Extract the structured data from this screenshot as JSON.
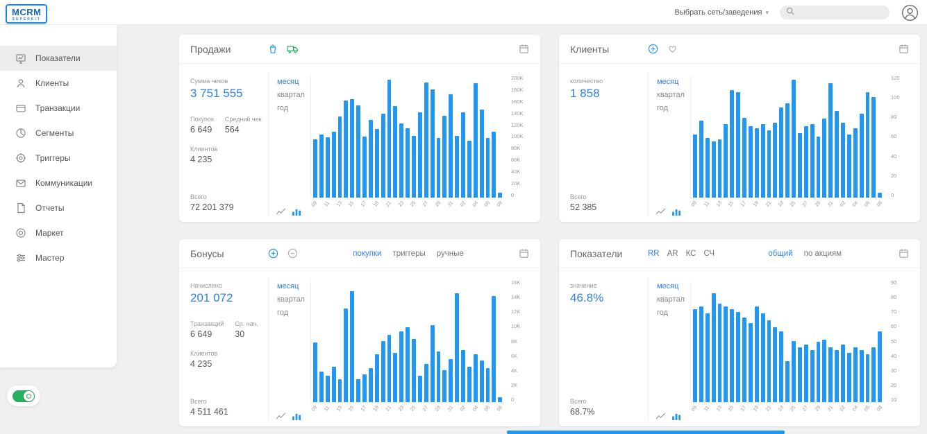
{
  "header": {
    "logo_title": "MCRM",
    "logo_subtitle": "SUPERKIT",
    "network_select": "Выбрать сеть/заведения",
    "search_placeholder": "",
    "icons": [
      "chevron-down-icon",
      "search-icon",
      "profile-icon"
    ]
  },
  "sidebar": {
    "items": [
      {
        "key": "metrics",
        "label": "Показатели",
        "icon": "metrics-icon",
        "active": true
      },
      {
        "key": "clients",
        "label": "Клиенты",
        "icon": "clients-icon",
        "active": false
      },
      {
        "key": "transactions",
        "label": "Транзакции",
        "icon": "transactions-icon",
        "active": false
      },
      {
        "key": "segments",
        "label": "Сегменты",
        "icon": "segments-icon",
        "active": false
      },
      {
        "key": "triggers",
        "label": "Триггеры",
        "icon": "triggers-icon",
        "active": false
      },
      {
        "key": "communications",
        "label": "Коммуникации",
        "icon": "communications-icon",
        "active": false
      },
      {
        "key": "reports",
        "label": "Отчеты",
        "icon": "reports-icon",
        "active": false
      },
      {
        "key": "market",
        "label": "Маркет",
        "icon": "market-icon",
        "active": false
      },
      {
        "key": "master",
        "label": "Мастер",
        "icon": "master-icon",
        "active": false
      }
    ],
    "toggle_on": true
  },
  "cards": {
    "period_tabs": [
      "месяц",
      "квартал",
      "год"
    ],
    "active_period": "месяц",
    "sales": {
      "title": "Продажи",
      "icons": [
        "bag-icon",
        "delivery-truck-icon",
        "calendar-icon"
      ],
      "stats": {
        "main_label": "Сумма чеков",
        "main_value": "3 751 555",
        "row2": [
          {
            "label": "Покупок",
            "value": "6 649"
          },
          {
            "label": "Средний чек",
            "value": "564"
          }
        ],
        "row3": {
          "label": "Клиентов",
          "value": "4 235"
        },
        "total": {
          "label": "Всего",
          "value": "72 201 379"
        }
      }
    },
    "clients": {
      "title": "Клиенты",
      "icons": [
        "plus-circle-icon",
        "heart-icon",
        "calendar-icon"
      ],
      "stats": {
        "main_label": "количество",
        "main_value": "1 858",
        "total": {
          "label": "Всего",
          "value": "52 385"
        }
      }
    },
    "bonuses": {
      "title": "Бонусы",
      "icons": [
        "plus-circle-icon",
        "minus-circle-icon",
        "calendar-icon"
      ],
      "type_tabs": [
        {
          "label": "покупки",
          "active": true
        },
        {
          "label": "триггеры",
          "active": false
        },
        {
          "label": "ручные",
          "active": false
        }
      ],
      "stats": {
        "main_label": "Начислено",
        "main_value": "201 072",
        "row2": [
          {
            "label": "Транзакций",
            "value": "6 649"
          },
          {
            "label": "Ср. нач.",
            "value": "30"
          }
        ],
        "row3": {
          "label": "Клиентов",
          "value": "4 235"
        },
        "total": {
          "label": "Всего",
          "value": "4 511 461"
        }
      }
    },
    "indicators": {
      "title": "Показатели",
      "icons": [
        "calendar-icon"
      ],
      "metric_tabs": [
        {
          "label": "RR",
          "active": true
        },
        {
          "label": "AR",
          "active": false
        },
        {
          "label": "КС",
          "active": false
        },
        {
          "label": "СЧ",
          "active": false
        }
      ],
      "scope_tabs": [
        {
          "label": "общий",
          "active": true
        },
        {
          "label": "по акциям",
          "active": false
        }
      ],
      "stats": {
        "main_label": "значение",
        "main_value": "46.8%",
        "total": {
          "label": "Всего",
          "value": "68.7%"
        }
      }
    }
  },
  "colors": {
    "accent_blue": "#2f80ed",
    "bar_blue": "#2196f3",
    "green": "#27ae60"
  },
  "chart_data": [
    {
      "id": "sales",
      "type": "bar",
      "title": "Продажи — сумма чеков по дням",
      "categories": [
        "09",
        "10",
        "11",
        "12",
        "13",
        "14",
        "15",
        "16",
        "17",
        "18",
        "19",
        "20",
        "21",
        "22",
        "23",
        "24",
        "25",
        "26",
        "27",
        "28",
        "29",
        "30",
        "31",
        "01",
        "02",
        "03",
        "04",
        "05",
        "06",
        "07",
        "08"
      ],
      "values": [
        95000,
        103000,
        98000,
        107000,
        132000,
        158000,
        161000,
        150000,
        99000,
        127000,
        112000,
        137000,
        192000,
        149000,
        121000,
        113000,
        101000,
        139000,
        188000,
        176000,
        97000,
        133000,
        168000,
        101000,
        139000,
        93000,
        186000,
        143000,
        97000,
        107000,
        8000
      ],
      "ylim": [
        0,
        200000
      ],
      "ytick_labels": [
        "200K",
        "180K",
        "160K",
        "140K",
        "120K",
        "100K",
        "80K",
        "60K",
        "40K",
        "20K",
        "0"
      ],
      "xtick_labels": [
        "09",
        "11",
        "13",
        "15",
        "17",
        "19",
        "21",
        "23",
        "25",
        "27",
        "29",
        "31",
        "02",
        "04",
        "06",
        "08"
      ],
      "bar_color": "#2196f3",
      "grid": false,
      "yaxis_position": "right",
      "legend": "none"
    },
    {
      "id": "clients",
      "type": "bar",
      "title": "Клиенты — количество по дням",
      "categories": [
        "09",
        "10",
        "11",
        "12",
        "13",
        "14",
        "15",
        "16",
        "17",
        "18",
        "19",
        "20",
        "21",
        "22",
        "23",
        "24",
        "25",
        "26",
        "27",
        "28",
        "29",
        "30",
        "31",
        "01",
        "02",
        "03",
        "04",
        "05",
        "06",
        "07",
        "08"
      ],
      "values": [
        62,
        75,
        58,
        55,
        57,
        72,
        105,
        103,
        78,
        70,
        68,
        72,
        66,
        73,
        88,
        92,
        115,
        63,
        70,
        72,
        60,
        77,
        112,
        85,
        73,
        62,
        68,
        82,
        103,
        98,
        5
      ],
      "ylim": [
        0,
        120
      ],
      "ytick_labels": [
        "120",
        "100",
        "80",
        "60",
        "40",
        "20",
        "0"
      ],
      "xtick_labels": [
        "09",
        "11",
        "13",
        "15",
        "17",
        "19",
        "21",
        "23",
        "25",
        "27",
        "29",
        "31",
        "02",
        "04",
        "06",
        "08"
      ],
      "bar_color": "#2196f3",
      "grid": false,
      "yaxis_position": "right",
      "legend": "none"
    },
    {
      "id": "bonuses",
      "type": "bar",
      "title": "Бонусы — начислено по дням",
      "categories": [
        "09",
        "10",
        "11",
        "12",
        "13",
        "14",
        "15",
        "16",
        "17",
        "18",
        "19",
        "20",
        "21",
        "22",
        "23",
        "24",
        "25",
        "26",
        "27",
        "28",
        "29",
        "30",
        "31",
        "01",
        "02",
        "03",
        "04",
        "05",
        "06",
        "07",
        "08"
      ],
      "values": [
        7800,
        4000,
        3400,
        4600,
        3000,
        12200,
        14500,
        3000,
        3600,
        4400,
        6200,
        8000,
        8800,
        6400,
        9200,
        9800,
        8200,
        3400,
        5000,
        10000,
        6600,
        4200,
        5600,
        14200,
        6800,
        4600,
        6200,
        5400,
        4400,
        13800,
        600
      ],
      "ylim": [
        0,
        16000
      ],
      "ytick_labels": [
        "16K",
        "14K",
        "12K",
        "10K",
        "8K",
        "6K",
        "4K",
        "2K",
        "0"
      ],
      "xtick_labels": [
        "09",
        "11",
        "13",
        "15",
        "17",
        "19",
        "21",
        "23",
        "25",
        "27",
        "29",
        "31",
        "02",
        "04",
        "06",
        "08"
      ],
      "bar_color": "#2196f3",
      "grid": false,
      "yaxis_position": "right",
      "legend": "none"
    },
    {
      "id": "indicators",
      "type": "bar",
      "title": "Показатели RR — значение по дням",
      "categories": [
        "09",
        "10",
        "11",
        "12",
        "13",
        "14",
        "15",
        "16",
        "17",
        "18",
        "19",
        "20",
        "21",
        "22",
        "23",
        "24",
        "25",
        "26",
        "27",
        "28",
        "29",
        "30",
        "31",
        "01",
        "02",
        "03",
        "04",
        "05",
        "06",
        "07",
        "08"
      ],
      "values": [
        68,
        70,
        65,
        80,
        72,
        70,
        68,
        66,
        62,
        58,
        70,
        65,
        60,
        55,
        52,
        30,
        45,
        40,
        42,
        38,
        44,
        46,
        40,
        38,
        42,
        36,
        40,
        38,
        35,
        40,
        52
      ],
      "ylim": [
        0,
        90
      ],
      "ytick_labels": [
        "90",
        "80",
        "70",
        "60",
        "50",
        "40",
        "30",
        "20",
        "10"
      ],
      "xtick_labels": [
        "09",
        "11",
        "13",
        "15",
        "17",
        "19",
        "21",
        "23",
        "25",
        "27",
        "29",
        "31",
        "02",
        "04",
        "06",
        "08"
      ],
      "bar_color": "#2196f3",
      "grid": false,
      "yaxis_position": "right",
      "legend": "none"
    }
  ]
}
